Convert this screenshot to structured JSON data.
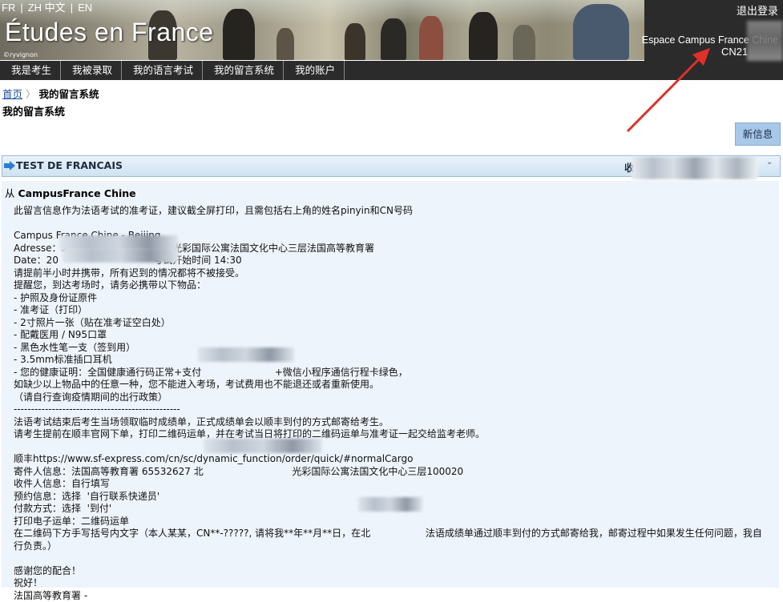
{
  "header": {
    "languages": [
      "FR",
      "|",
      "ZH 中文",
      "|",
      "EN"
    ],
    "site_title": "Études en France",
    "photo_credit": "©ryvignon",
    "logout": "退出登录",
    "space_name": "Espace Campus France Chine",
    "account_id": "CN21"
  },
  "nav": {
    "items": [
      "我是考生",
      "我被录取",
      "我的语言考试",
      "我的留言系统",
      "我的账户"
    ]
  },
  "breadcrumb": {
    "home": "首页",
    "current": "我的留言系统"
  },
  "page_title": "我的留言系统",
  "new_message_button": "新信息",
  "message": {
    "subject": "TEST DE FRANCAIS",
    "received_label": "收",
    "from_prefix": "从",
    "from_name": "CampusFrance Chine",
    "lines": [
      "此留言信息作为法语考试的准考证，建议截全屏打印，且需包括右上角的姓名pinyin和CN号码",
      "",
      "Campus France Chine - Beijing",
      "Adresse：北                              ，光彩国际公寓法国文化中心三层法国高等教育署",
      "Date：20                               考试开始时间 14:30",
      "请提前半小时并携带，所有迟到的情况都将不被接受。",
      "提醒您，到达考场时，请务必携带以下物品：",
      "- 护照及身份证原件",
      "- 准考证（打印）",
      "- 2寸照片一张（贴在准考证空白处）",
      "- 配戴医用 / N95口罩",
      "- 黑色水性笔一支（签到用）",
      "- 3.5mm标准插口耳机",
      "- 您的健康证明：全国健康通行码正常+支付                        +微信小程序通信行程卡绿色，",
      "如缺少以上物品中的任意一种，您不能进入考场，考试费用也不能退还或者重新使用。",
      "（请自行查询疫情期间的出行政策）",
      "------------------------------------------------",
      "法语考试结束后考生当场领取临时成绩单，正式成绩单会以顺丰到付的方式邮寄给考生。",
      "请考生提前在顺丰官网下单，打印二维码运单，并在考试当日将打印的二维码运单与准考证一起交给监考老师。",
      "",
      "顺丰https://www.sf-express.com/cn/sc/dynamic_function/order/quick/#normalCargo",
      "寄件人信息：法国高等教育署 65532627 北                             光彩国际公寓法国文化中心三层100020",
      "收件人信息：自行填写",
      "预约信息：选择  '自行联系快递员'",
      "付款方式：选择  '到付'",
      "打印电子运单：二维码运单",
      "在二维码下方手写括号内文字（本人某某，CN**-?????, 请将我**年**月**日，在北                  法语成绩单通过顺丰到付的方式邮寄给我，邮寄过程中如果发生任何问题，我自",
      "行负责。）",
      "",
      "感谢您的配合！",
      "祝好！",
      "法国高等教育署 -"
    ]
  }
}
